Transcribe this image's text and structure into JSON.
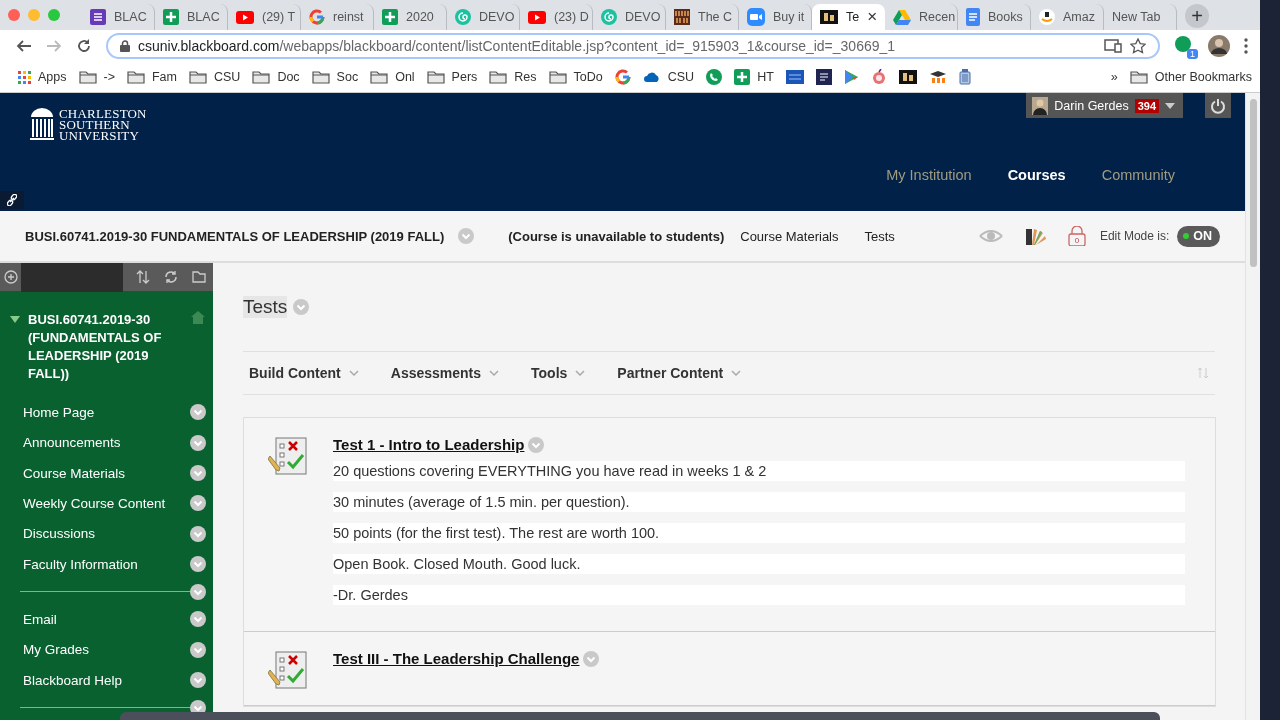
{
  "browser": {
    "tabs": [
      {
        "kind": "form",
        "label": "BLAC",
        "selected": false
      },
      {
        "kind": "sheets",
        "label": "BLAC",
        "selected": false
      },
      {
        "kind": "youtube",
        "label": "(29) T",
        "selected": false
      },
      {
        "kind": "google",
        "label": "reinst",
        "selected": false
      },
      {
        "kind": "sheets",
        "label": "2020",
        "selected": false
      },
      {
        "kind": "swirl",
        "label": "DEVO",
        "selected": false
      },
      {
        "kind": "youtube",
        "label": "(23) D",
        "selected": false
      },
      {
        "kind": "swirl",
        "label": "DEVO",
        "selected": false
      },
      {
        "kind": "books",
        "label": "The C",
        "selected": false
      },
      {
        "kind": "zoom",
        "label": "Buy it",
        "selected": false
      },
      {
        "kind": "bb",
        "label": "Te",
        "selected": true,
        "close": "×"
      },
      {
        "kind": "drive",
        "label": "Recen",
        "selected": false
      },
      {
        "kind": "docs",
        "label": "Books",
        "selected": false
      },
      {
        "kind": "amazon",
        "label": "Amaz",
        "selected": false
      },
      {
        "kind": "none",
        "label": "New Tab",
        "selected": false
      }
    ],
    "new_tab": "+",
    "url_host": "csuniv.blackboard.com",
    "url_path": "/webapps/blackboard/content/listContentEditable.jsp?content_id=_915903_1&course_id=_30669_1",
    "extension_badge": "1",
    "bookmarks": [
      {
        "kind": "apps",
        "label": "Apps"
      },
      {
        "kind": "folder",
        "label": "->"
      },
      {
        "kind": "folder",
        "label": "Fam"
      },
      {
        "kind": "folder",
        "label": "CSU"
      },
      {
        "kind": "folder",
        "label": "Doc"
      },
      {
        "kind": "folder",
        "label": "Soc"
      },
      {
        "kind": "folder",
        "label": "Onl"
      },
      {
        "kind": "folder",
        "label": "Pers"
      },
      {
        "kind": "folder",
        "label": "Res"
      },
      {
        "kind": "folder",
        "label": "ToDo"
      },
      {
        "kind": "google"
      },
      {
        "kind": "cloud",
        "label": "CSU"
      },
      {
        "kind": "phone"
      },
      {
        "kind": "sheets",
        "label": "HT"
      },
      {
        "kind": "tile-blue"
      },
      {
        "kind": "tile-navy"
      },
      {
        "kind": "play"
      },
      {
        "kind": "onion"
      },
      {
        "kind": "bb"
      },
      {
        "kind": "cap"
      },
      {
        "kind": "bin"
      }
    ],
    "overflow": "»",
    "other_bookmarks": "Other Bookmarks"
  },
  "header": {
    "logo_lines": [
      "CHARLESTON",
      "SOUTHERN",
      "UNIVERSITY"
    ],
    "user": "Darin Gerdes",
    "user_badge": "394",
    "nav": [
      {
        "label": "My Institution",
        "selected": false
      },
      {
        "label": "Courses",
        "selected": true
      },
      {
        "label": "Community",
        "selected": false
      }
    ]
  },
  "course_bar": {
    "title": "BUSI.60741.2019-30 FUNDAMENTALS OF LEADERSHIP (2019 FALL)",
    "status": "(Course is unavailable to students)",
    "breadcrumbs": [
      "Course Materials",
      "Tests"
    ],
    "lock_count": "0",
    "edit_mode_label": "Edit Mode is:",
    "edit_mode": {
      "on": true,
      "label": "ON"
    }
  },
  "sidebar": {
    "course_title": "BUSI.60741.2019-30 (FUNDAMENTALS OF LEADERSHIP (2019 FALL))",
    "expanded": true,
    "items": [
      {
        "kind": "link",
        "label": "Home Page"
      },
      {
        "kind": "link",
        "label": "Announcements"
      },
      {
        "kind": "link",
        "label": "Course Materials"
      },
      {
        "kind": "link",
        "label": "Weekly Course Content"
      },
      {
        "kind": "link",
        "label": "Discussions"
      },
      {
        "kind": "link",
        "label": "Faculty Information"
      },
      {
        "kind": "divider"
      },
      {
        "kind": "link",
        "label": "Email"
      },
      {
        "kind": "link",
        "label": "My Grades"
      },
      {
        "kind": "link",
        "label": "Blackboard Help"
      },
      {
        "kind": "divider"
      }
    ]
  },
  "content": {
    "title": "Tests",
    "actions": [
      "Build Content",
      "Assessments",
      "Tools",
      "Partner Content"
    ],
    "items": [
      {
        "title": "Test 1 - Intro to Leadership",
        "lines": [
          "20 questions covering EVERYTHING you have read in weeks 1 & 2",
          "30 minutes (average of 1.5 min. per question).",
          "50 points  (for the first test). The rest are worth 100.",
          "Open Book. Closed Mouth. Good luck.",
          "-Dr. Gerdes"
        ]
      },
      {
        "title": "Test III - The Leadership Challenge"
      }
    ]
  }
}
